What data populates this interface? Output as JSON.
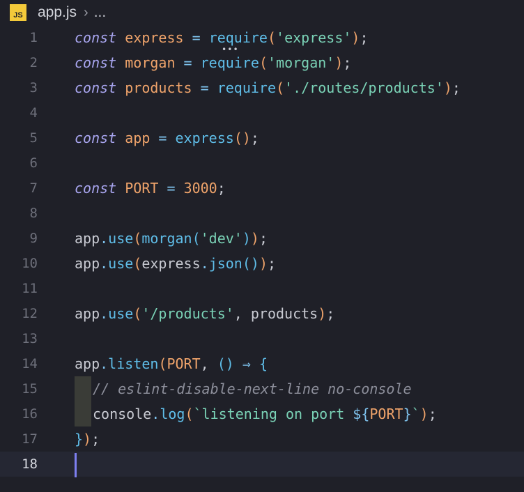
{
  "breadcrumb": {
    "icon_label": "JS",
    "file": "app.js",
    "chevron": "›",
    "more": "..."
  },
  "lines": [
    {
      "n": "1",
      "tokens": [
        {
          "t": "const",
          "c": "kw"
        },
        {
          "t": " ",
          "c": "pl"
        },
        {
          "t": "express",
          "c": "var"
        },
        {
          "t": " = ",
          "c": "op"
        },
        {
          "t": "require",
          "c": "fn"
        },
        {
          "t": "(",
          "c": "br"
        },
        {
          "t": "'express'",
          "c": "str"
        },
        {
          "t": ")",
          "c": "br"
        },
        {
          "t": ";",
          "c": "pl"
        }
      ]
    },
    {
      "n": "2",
      "tokens": [
        {
          "t": "const",
          "c": "kw"
        },
        {
          "t": " ",
          "c": "pl"
        },
        {
          "t": "morgan",
          "c": "var"
        },
        {
          "t": " = ",
          "c": "op"
        },
        {
          "t": "require",
          "c": "fn"
        },
        {
          "t": "(",
          "c": "br"
        },
        {
          "t": "'morgan'",
          "c": "str"
        },
        {
          "t": ")",
          "c": "br"
        },
        {
          "t": ";",
          "c": "pl"
        }
      ]
    },
    {
      "n": "3",
      "tokens": [
        {
          "t": "const",
          "c": "kw"
        },
        {
          "t": " ",
          "c": "pl"
        },
        {
          "t": "products",
          "c": "var"
        },
        {
          "t": " = ",
          "c": "op"
        },
        {
          "t": "require",
          "c": "fn"
        },
        {
          "t": "(",
          "c": "br"
        },
        {
          "t": "'./routes/products'",
          "c": "str"
        },
        {
          "t": ")",
          "c": "br"
        },
        {
          "t": ";",
          "c": "pl"
        }
      ]
    },
    {
      "n": "4",
      "tokens": []
    },
    {
      "n": "5",
      "tokens": [
        {
          "t": "const",
          "c": "kw"
        },
        {
          "t": " ",
          "c": "pl"
        },
        {
          "t": "app",
          "c": "var"
        },
        {
          "t": " = ",
          "c": "op"
        },
        {
          "t": "express",
          "c": "fn"
        },
        {
          "t": "()",
          "c": "br"
        },
        {
          "t": ";",
          "c": "pl"
        }
      ]
    },
    {
      "n": "6",
      "tokens": []
    },
    {
      "n": "7",
      "tokens": [
        {
          "t": "const",
          "c": "kw"
        },
        {
          "t": " ",
          "c": "pl"
        },
        {
          "t": "PORT",
          "c": "var"
        },
        {
          "t": " = ",
          "c": "op"
        },
        {
          "t": "3000",
          "c": "num"
        },
        {
          "t": ";",
          "c": "pl"
        }
      ]
    },
    {
      "n": "8",
      "tokens": []
    },
    {
      "n": "9",
      "tokens": [
        {
          "t": "app",
          "c": "pl"
        },
        {
          "t": ".",
          "c": "op"
        },
        {
          "t": "use",
          "c": "fn"
        },
        {
          "t": "(",
          "c": "br"
        },
        {
          "t": "morgan",
          "c": "fn"
        },
        {
          "t": "(",
          "c": "br2"
        },
        {
          "t": "'dev'",
          "c": "str"
        },
        {
          "t": ")",
          "c": "br2"
        },
        {
          "t": ")",
          "c": "br"
        },
        {
          "t": ";",
          "c": "pl"
        }
      ]
    },
    {
      "n": "10",
      "tokens": [
        {
          "t": "app",
          "c": "pl"
        },
        {
          "t": ".",
          "c": "op"
        },
        {
          "t": "use",
          "c": "fn"
        },
        {
          "t": "(",
          "c": "br"
        },
        {
          "t": "express",
          "c": "pl"
        },
        {
          "t": ".",
          "c": "op"
        },
        {
          "t": "json",
          "c": "fn"
        },
        {
          "t": "()",
          "c": "br2"
        },
        {
          "t": ")",
          "c": "br"
        },
        {
          "t": ";",
          "c": "pl"
        }
      ]
    },
    {
      "n": "11",
      "tokens": []
    },
    {
      "n": "12",
      "tokens": [
        {
          "t": "app",
          "c": "pl"
        },
        {
          "t": ".",
          "c": "op"
        },
        {
          "t": "use",
          "c": "fn"
        },
        {
          "t": "(",
          "c": "br"
        },
        {
          "t": "'/products'",
          "c": "str"
        },
        {
          "t": ", ",
          "c": "pl"
        },
        {
          "t": "products",
          "c": "pl"
        },
        {
          "t": ")",
          "c": "br"
        },
        {
          "t": ";",
          "c": "pl"
        }
      ]
    },
    {
      "n": "13",
      "tokens": []
    },
    {
      "n": "14",
      "tokens": [
        {
          "t": "app",
          "c": "pl"
        },
        {
          "t": ".",
          "c": "op"
        },
        {
          "t": "listen",
          "c": "fn"
        },
        {
          "t": "(",
          "c": "br"
        },
        {
          "t": "PORT",
          "c": "var"
        },
        {
          "t": ", ",
          "c": "pl"
        },
        {
          "t": "()",
          "c": "br2"
        },
        {
          "t": " ⇒ ",
          "c": "op"
        },
        {
          "t": "{",
          "c": "br2"
        }
      ]
    },
    {
      "n": "15",
      "indent": true,
      "tokens": [
        {
          "t": "// eslint-disable-next-line no-console",
          "c": "cm"
        }
      ]
    },
    {
      "n": "16",
      "indent": true,
      "tokens": [
        {
          "t": "console",
          "c": "pl"
        },
        {
          "t": ".",
          "c": "op"
        },
        {
          "t": "log",
          "c": "fn"
        },
        {
          "t": "(",
          "c": "br"
        },
        {
          "t": "`listening on port ",
          "c": "str"
        },
        {
          "t": "${",
          "c": "op"
        },
        {
          "t": "PORT",
          "c": "var"
        },
        {
          "t": "}",
          "c": "op"
        },
        {
          "t": "`",
          "c": "str"
        },
        {
          "t": ")",
          "c": "br"
        },
        {
          "t": ";",
          "c": "pl"
        }
      ]
    },
    {
      "n": "17",
      "tokens": [
        {
          "t": "}",
          "c": "br2"
        },
        {
          "t": ")",
          "c": "br"
        },
        {
          "t": ";",
          "c": "pl"
        }
      ]
    },
    {
      "n": "18",
      "current": true,
      "tokens": []
    }
  ]
}
